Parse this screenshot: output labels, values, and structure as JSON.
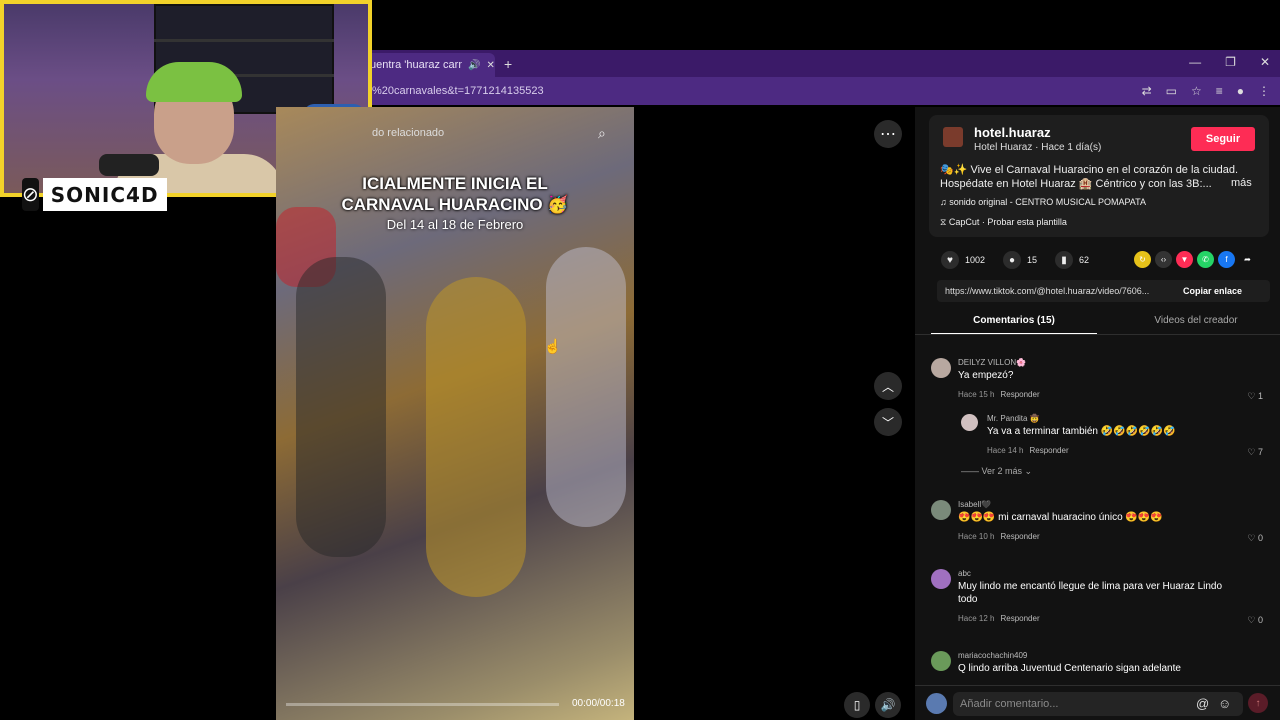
{
  "browser": {
    "tab_title": "uentra 'huaraz carnavale",
    "url": "%20carnavales&t=1771214135523"
  },
  "webcam": {
    "logo_text": "SONIC4D"
  },
  "video": {
    "search_text": "do relacionado",
    "title_line1": "ICIALMENTE INICIA EL",
    "title_line2": "CARNAVAL HUARACINO 🥳",
    "subtitle": "Del 14 al 18 de Febrero",
    "time": "00:00/00:18",
    "progress": 0
  },
  "creator": {
    "username": "hotel.huaraz",
    "subline": "Hotel Huaraz · Hace 1 día(s)",
    "follow_label": "Seguir",
    "description": "🎭✨ Vive el Carnaval Huaracino en el corazón de la ciudad. Hospédate en Hotel Huaraz 🏨 Céntrico y con las 3B:...",
    "more_label": "más",
    "sound": "♫  sonido original - CENTRO MUSICAL POMAPATA",
    "capcut": "⧖  CapCut · Probar esta plantilla"
  },
  "stats": {
    "likes": "1002",
    "comments": "15",
    "saves": "62"
  },
  "share": {
    "link": "https://www.tiktok.com/@hotel.huaraz/video/7606...",
    "copy_label": "Copiar enlace"
  },
  "tabs": {
    "comments": "Comentarios (15)",
    "creator_videos": "Videos del creador"
  },
  "comments": [
    {
      "user": "DEILYZ VILLON🌸",
      "text": "Ya empezó?",
      "time": "Hace 15 h",
      "reply": "Responder",
      "likes": "1"
    },
    {
      "user": "Mr. Pandita 🤠",
      "text": "Ya va a terminar también 🤣🤣🤣🤣🤣🤣",
      "time": "Hace 14 h",
      "reply": "Responder",
      "likes": "7"
    },
    {
      "user": "Isabell🖤",
      "text": "😍😍😍 mi carnaval huaracino único 😍😍😍",
      "time": "Hace 10 h",
      "reply": "Responder",
      "likes": "0"
    },
    {
      "user": "abc",
      "text": "Muy lindo me encantó llegue de lima para ver Huaraz Lindo todo",
      "time": "Hace 12 h",
      "reply": "Responder",
      "likes": "0"
    },
    {
      "user": "mariacochachin409",
      "text": "Q lindo arriba Juventud Centenario sigan adelante",
      "time": "",
      "reply": "",
      "likes": ""
    }
  ],
  "more_replies": "Ver 2 más",
  "input": {
    "placeholder": "Añadir comentario..."
  }
}
